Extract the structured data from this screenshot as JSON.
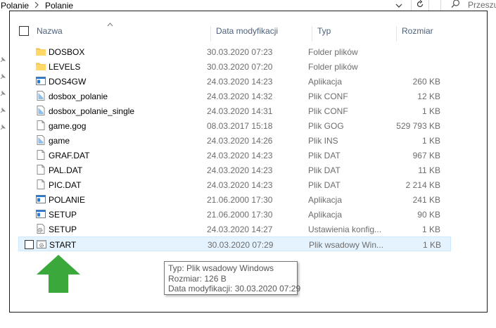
{
  "address": {
    "crumbs": [
      "Polanie",
      "Polanie"
    ],
    "separator_icon": "chevron-right-icon",
    "dropdown_icon": "chevron-down-icon",
    "refresh_icon": "refresh-icon",
    "search_icon": "search-icon",
    "search_placeholder": "Przeszu"
  },
  "columns": {
    "name": "Nazwa",
    "date": "Data modyfikacji",
    "type": "Typ",
    "size": "Rozmiar"
  },
  "files": [
    {
      "name": "DOSBOX",
      "date": "30.03.2020 07:23",
      "type": "Folder plików",
      "size": "",
      "icon": "folder-icon"
    },
    {
      "name": "LEVELS",
      "date": "30.03.2020 07:20",
      "type": "Folder plików",
      "size": "",
      "icon": "folder-icon"
    },
    {
      "name": "DOS4GW",
      "date": "24.03.2020 14:23",
      "type": "Aplikacja",
      "size": "260 KB",
      "icon": "application-icon"
    },
    {
      "name": "dosbox_polanie",
      "date": "24.03.2020 14:32",
      "type": "Plik CONF",
      "size": "12 KB",
      "icon": "config-file-icon"
    },
    {
      "name": "dosbox_polanie_single",
      "date": "24.03.2020 14:31",
      "type": "Plik CONF",
      "size": "1 KB",
      "icon": "config-file-icon"
    },
    {
      "name": "game.gog",
      "date": "08.03.2017 15:18",
      "type": "Plik GOG",
      "size": "529 793 KB",
      "icon": "file-icon"
    },
    {
      "name": "game",
      "date": "24.03.2020 14:26",
      "type": "Plik INS",
      "size": "1 KB",
      "icon": "config-file-icon"
    },
    {
      "name": "GRAF.DAT",
      "date": "24.03.2020 14:23",
      "type": "Plik DAT",
      "size": "967 KB",
      "icon": "file-icon"
    },
    {
      "name": "PAL.DAT",
      "date": "24.03.2020 14:23",
      "type": "Plik DAT",
      "size": "11 KB",
      "icon": "file-icon"
    },
    {
      "name": "PIC.DAT",
      "date": "24.03.2020 14:23",
      "type": "Plik DAT",
      "size": "2 214 KB",
      "icon": "file-icon"
    },
    {
      "name": "POLANIE",
      "date": "21.06.2000 17:30",
      "type": "Aplikacja",
      "size": "241 KB",
      "icon": "application-icon"
    },
    {
      "name": "SETUP",
      "date": "21.06.2000 17:30",
      "type": "Aplikacja",
      "size": "90 KB",
      "icon": "application-icon"
    },
    {
      "name": "SETUP",
      "date": "24.03.2020 14:27",
      "type": "Ustawienia konfig...",
      "size": "1 KB",
      "icon": "settings-file-icon"
    },
    {
      "name": "START",
      "date": "30.03.2020 07:29",
      "type": "Plik wsadowy Win...",
      "size": "1 KB",
      "icon": "batch-file-icon",
      "highlighted": true
    }
  ],
  "tooltip": {
    "line1": "Typ: Plik wsadowy Windows",
    "line2": "Rozmiar: 126 B",
    "line3": "Data modyfikacji: 30.03.2020 07:29"
  },
  "colors": {
    "folder": "#ffd866",
    "highlight": "#e5f3ff",
    "highlight_border": "#cce8ff",
    "header_text": "#4c607a",
    "secondary_text": "#6d6d6d",
    "annotation_arrow": "#3aa83a"
  },
  "annotation_icon": "green-up-arrow-icon"
}
